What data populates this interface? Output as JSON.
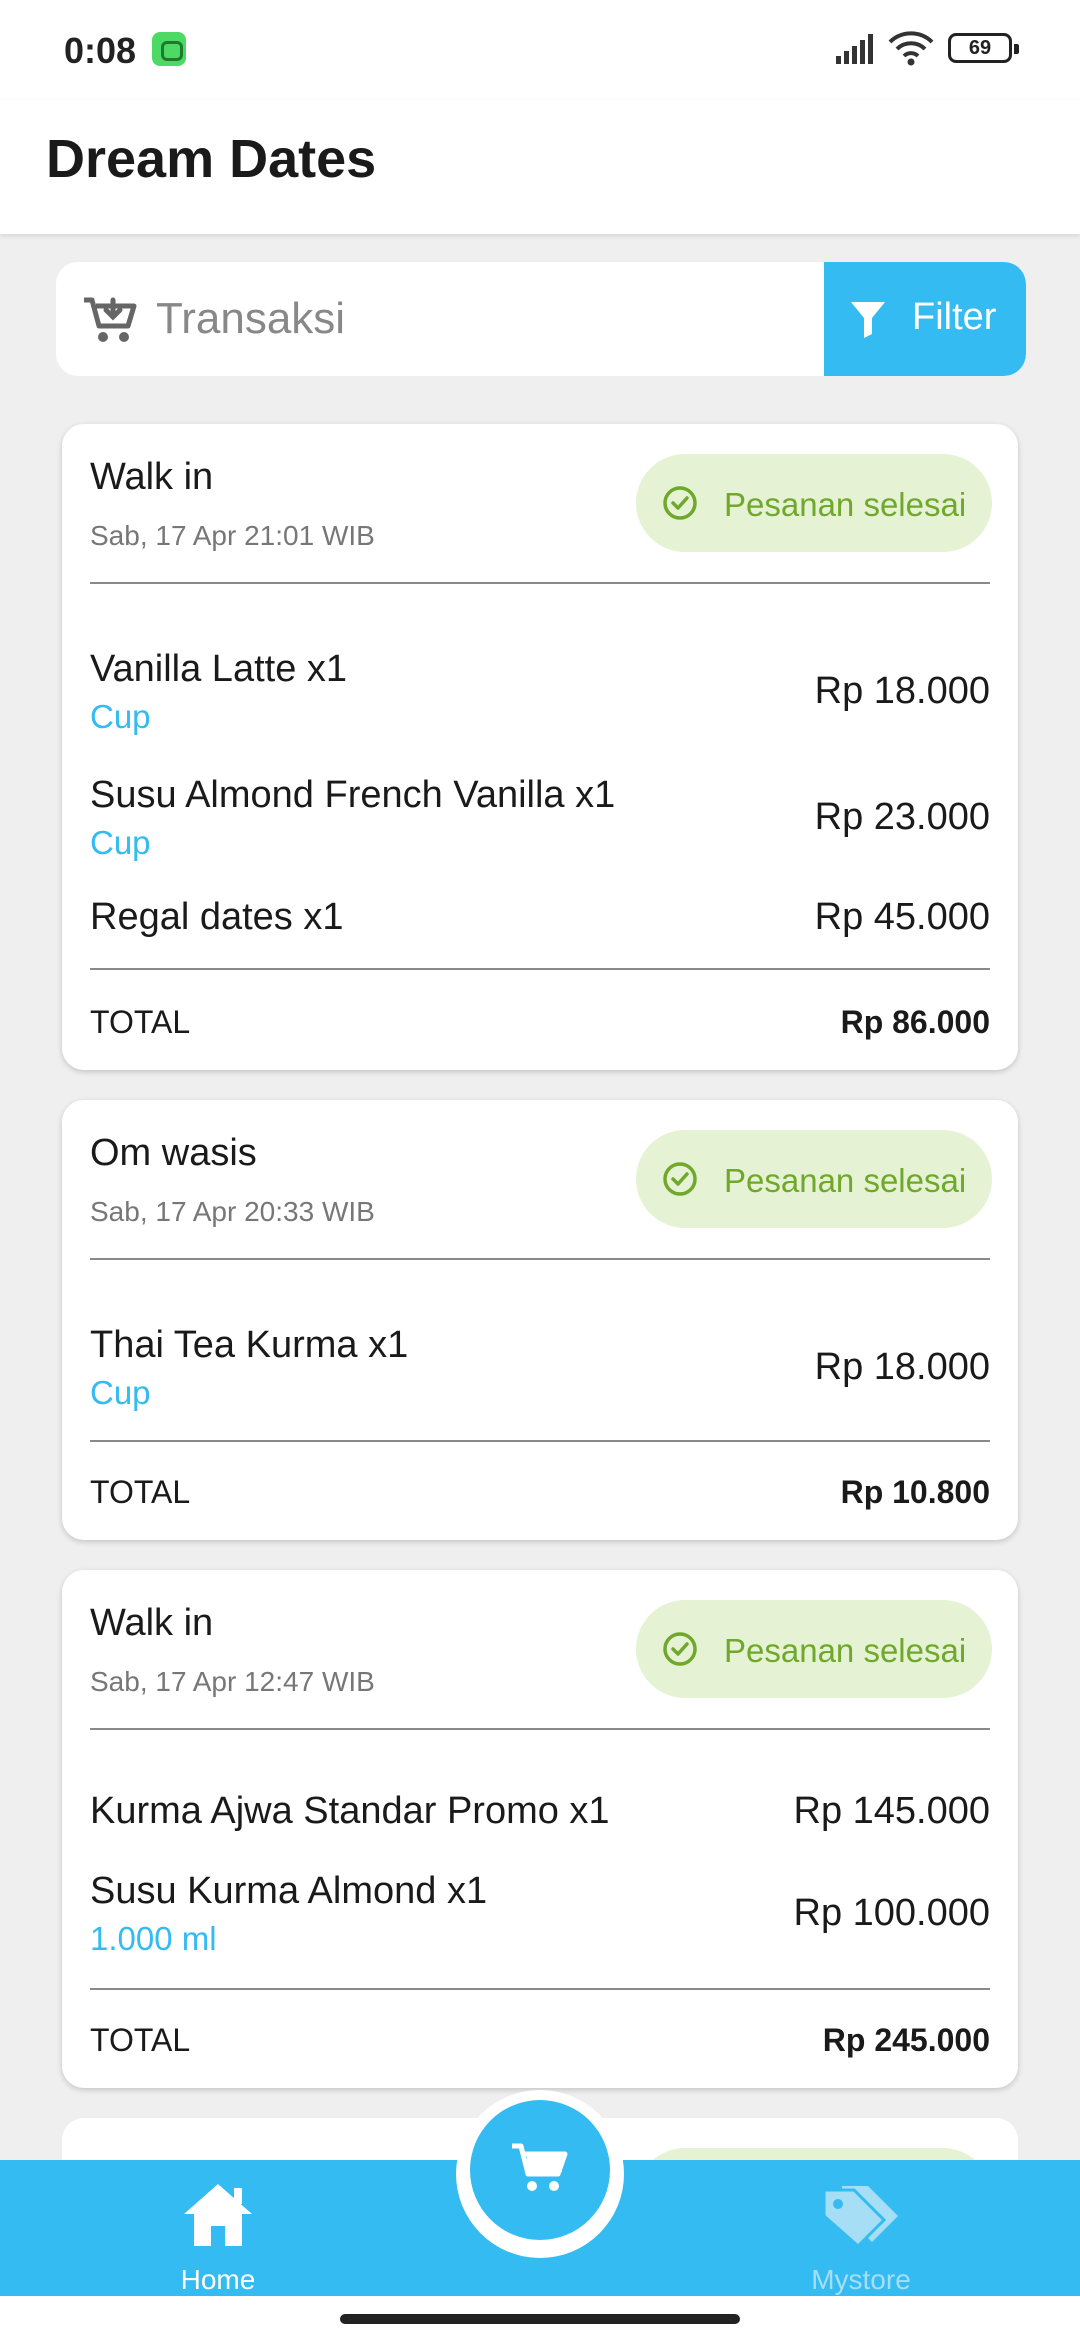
{
  "status_bar": {
    "time": "0:08",
    "battery": "69"
  },
  "app_bar": {
    "title": "Dream Dates"
  },
  "search": {
    "placeholder": "Transaksi",
    "filter_label": "Filter"
  },
  "orders": [
    {
      "customer": "Walk in",
      "date": "Sab, 17 Apr 21:01 WIB",
      "status": "Pesanan selesai",
      "items": [
        {
          "name": "Vanilla Latte x1",
          "variant": "Cup",
          "price": "Rp 18.000"
        },
        {
          "name": "Susu Almond French Vanilla x1",
          "variant": "Cup",
          "price": "Rp 23.000"
        },
        {
          "name": "Regal dates x1",
          "variant": "",
          "price": "Rp 45.000"
        }
      ],
      "total_label": "TOTAL",
      "total": "Rp 86.000"
    },
    {
      "customer": "Om wasis",
      "date": "Sab, 17 Apr 20:33 WIB",
      "status": "Pesanan selesai",
      "items": [
        {
          "name": "Thai Tea Kurma x1",
          "variant": "Cup",
          "price": "Rp 18.000"
        }
      ],
      "total_label": "TOTAL",
      "total": "Rp 10.800"
    },
    {
      "customer": "Walk in",
      "date": "Sab, 17 Apr 12:47 WIB",
      "status": "Pesanan selesai",
      "items": [
        {
          "name": "Kurma Ajwa Standar Promo x1",
          "variant": "",
          "price": "Rp 145.000"
        },
        {
          "name": "Susu Kurma Almond x1",
          "variant": "1.000 ml",
          "price": "Rp 100.000"
        }
      ],
      "total_label": "TOTAL",
      "total": "Rp 245.000"
    }
  ],
  "bottom_nav": {
    "home_label": "Home",
    "store_label": "Mystore"
  },
  "colors": {
    "accent": "#33bbf2",
    "status_badge_bg": "#e5f2d4",
    "status_badge_text": "#6fa82b"
  },
  "icons": {
    "search": "cart-download-icon",
    "filter": "funnel-icon",
    "status": "check-circle-icon",
    "home": "home-icon",
    "store": "tags-icon",
    "fab": "cart-icon"
  }
}
